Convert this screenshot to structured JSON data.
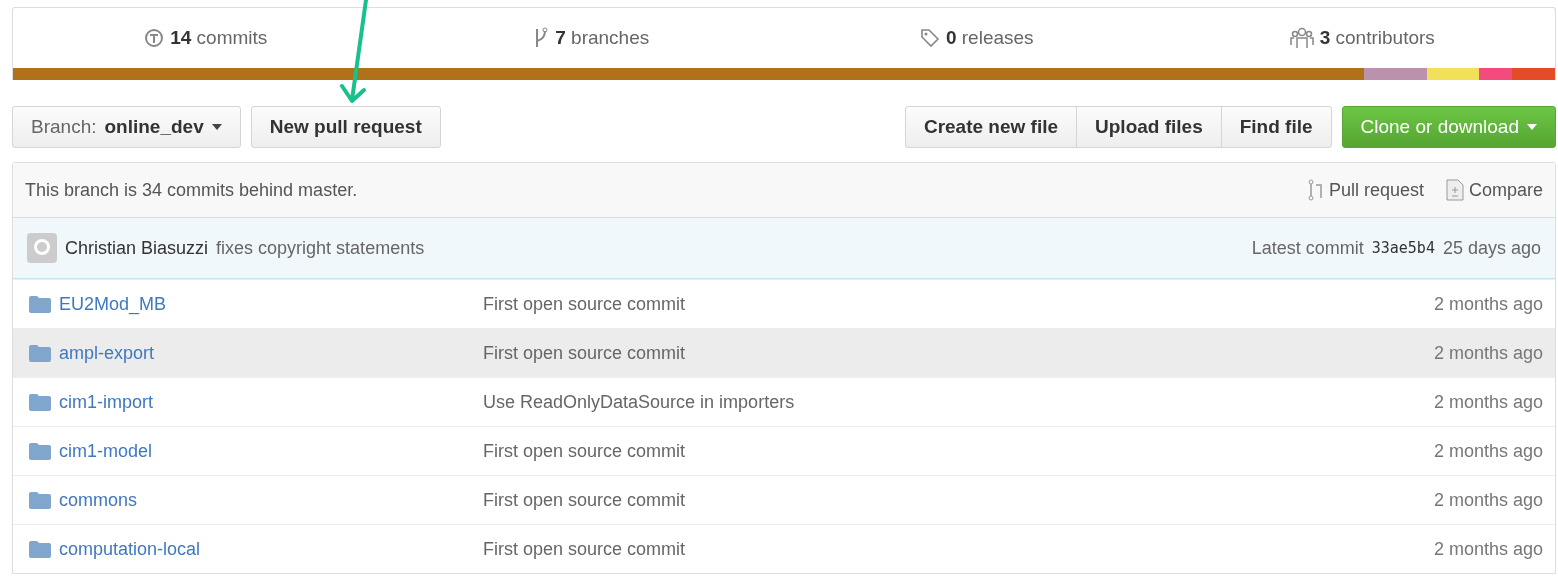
{
  "stats": [
    {
      "kind": "commits",
      "count": "14",
      "label": "commits"
    },
    {
      "kind": "branches",
      "count": "7",
      "label": "branches"
    },
    {
      "kind": "releases",
      "count": "0",
      "label": "releases"
    },
    {
      "kind": "contributors",
      "count": "3",
      "label": "contributors"
    }
  ],
  "languages": [
    {
      "color": "#b07219"
    },
    {
      "color": "#bb92ac"
    },
    {
      "color": "#f1e05a"
    },
    {
      "color": "#f34b7d"
    },
    {
      "color": "#e34c26"
    }
  ],
  "branch_select": {
    "label": "Branch:",
    "value": "online_dev"
  },
  "new_pull_request": "New pull request",
  "file_buttons": [
    "Create new file",
    "Upload files",
    "Find file"
  ],
  "clone_button": "Clone or download",
  "branch_info": {
    "text": "This branch is 34 commits behind master.",
    "pull_request": "Pull request",
    "compare": "Compare"
  },
  "latest_commit": {
    "author": "Christian Biasuzzi",
    "message": "fixes copyright statements",
    "label": "Latest commit",
    "sha": "33ae5b4",
    "age": "25 days ago"
  },
  "files": [
    {
      "name": "EU2Mod_MB",
      "message": "First open source commit",
      "age": "2 months ago",
      "highlighted": false
    },
    {
      "name": "ampl-export",
      "message": "First open source commit",
      "age": "2 months ago",
      "highlighted": true
    },
    {
      "name": "cim1-import",
      "message": "Use ReadOnlyDataSource in importers",
      "age": "2 months ago",
      "highlighted": false
    },
    {
      "name": "cim1-model",
      "message": "First open source commit",
      "age": "2 months ago",
      "highlighted": false
    },
    {
      "name": "commons",
      "message": "First open source commit",
      "age": "2 months ago",
      "highlighted": false
    },
    {
      "name": "computation-local",
      "message": "First open source commit",
      "age": "2 months ago",
      "highlighted": false
    }
  ]
}
